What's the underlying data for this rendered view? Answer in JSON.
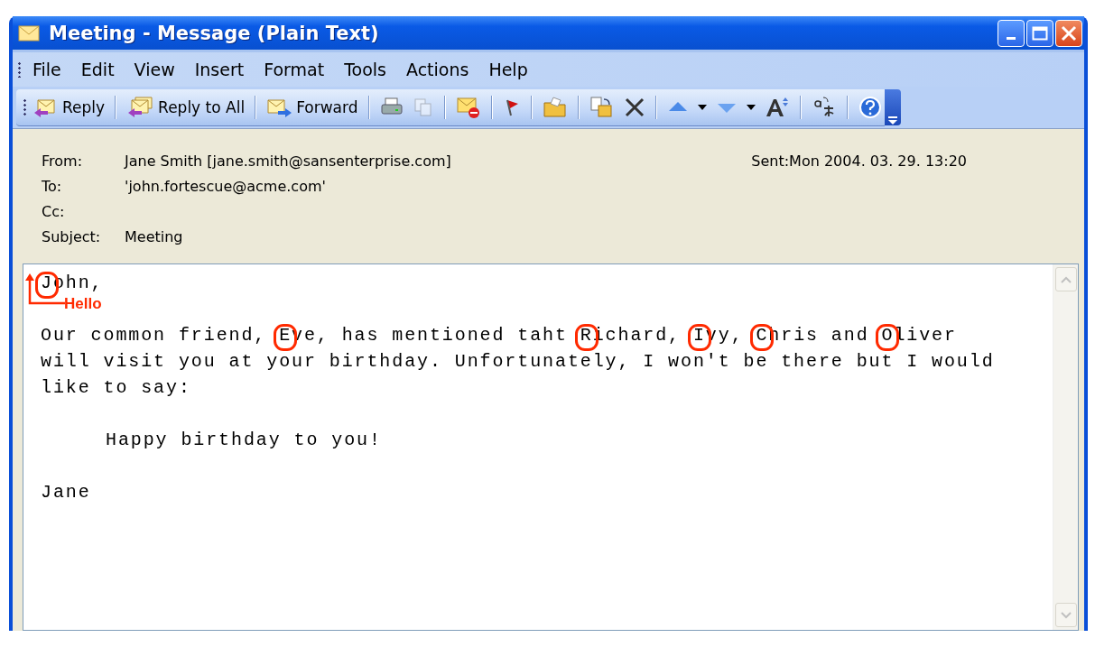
{
  "window": {
    "title": "Meeting - Message (Plain Text)"
  },
  "menu": [
    "File",
    "Edit",
    "View",
    "Insert",
    "Format",
    "Tools",
    "Actions",
    "Help"
  ],
  "toolbar": {
    "buttons": [
      "Reply",
      "Reply to All",
      "Forward"
    ]
  },
  "header": {
    "from_label": "From:",
    "from": "Jane Smith [jane.smith@sansenterprise.com]",
    "sent_label": "Sent:",
    "sent": "Mon 2004. 03. 29.  13:20",
    "to_label": "To:",
    "to": "'john.fortescue@acme.com'",
    "cc_label": "Cc:",
    "subject_label": "Subject:",
    "subject": "Meeting"
  },
  "body": {
    "annotation": {
      "label": "Hello"
    },
    "lines": [
      {
        "kind": "text",
        "segments": [
          {
            "text": "J",
            "circled": true
          },
          {
            "text": "ohn,",
            "circled": false
          }
        ]
      },
      {
        "kind": "blank"
      },
      {
        "kind": "text",
        "segments": [
          {
            "text": "Our common friend, ",
            "circled": false
          },
          {
            "text": "E",
            "circled": true
          },
          {
            "text": "ve, has mentioned taht ",
            "circled": false
          },
          {
            "text": "R",
            "circled": true
          },
          {
            "text": "ichard, ",
            "circled": false
          },
          {
            "text": "I",
            "circled": true
          },
          {
            "text": "vy, ",
            "circled": false
          },
          {
            "text": "C",
            "circled": true
          },
          {
            "text": "hris and ",
            "circled": false
          },
          {
            "text": "O",
            "circled": true
          },
          {
            "text": "liver",
            "circled": false
          }
        ]
      },
      {
        "kind": "text",
        "segments": [
          {
            "text": "will visit you at your birthday. Unfortunately, I won't be there but I would",
            "circled": false
          }
        ]
      },
      {
        "kind": "text",
        "segments": [
          {
            "text": "like to say:",
            "circled": false
          }
        ]
      },
      {
        "kind": "blank"
      },
      {
        "kind": "indented",
        "segments": [
          {
            "text": "Happy birthday to you!",
            "circled": false
          }
        ]
      },
      {
        "kind": "blank"
      },
      {
        "kind": "text",
        "segments": [
          {
            "text": "Jane",
            "circled": false
          }
        ]
      }
    ]
  }
}
